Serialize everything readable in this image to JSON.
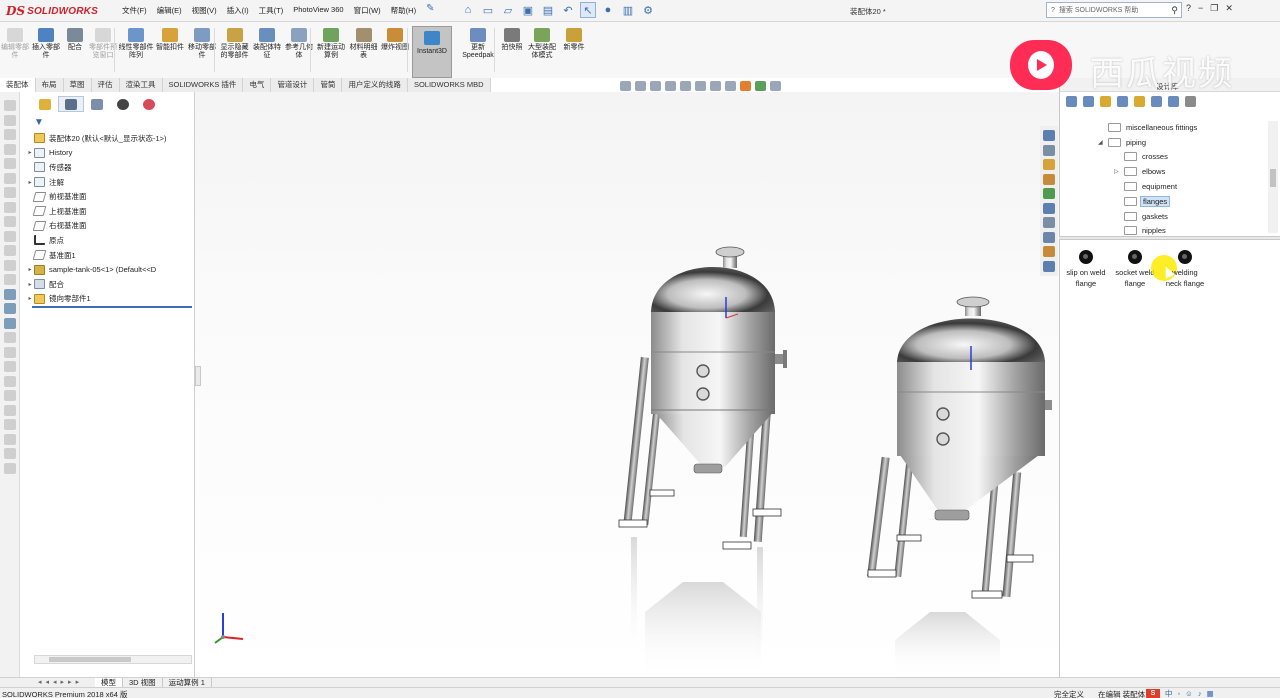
{
  "app": {
    "logo_ds": "DS",
    "logo_text": "SOLIDWORKS",
    "doc_title": "装配体20 *",
    "help_search_placeholder": "搜索 SOLIDWORKS 帮助"
  },
  "menu": [
    "文件(F)",
    "编辑(E)",
    "视图(V)",
    "插入(I)",
    "工具(T)",
    "PhotoView 360",
    "窗口(W)",
    "帮助(H)"
  ],
  "window_controls": [
    "?",
    "−",
    "❐",
    "✕"
  ],
  "ribbon": {
    "buttons": [
      {
        "label": "编辑零部件",
        "disabled": true,
        "color": "#c9c9c9"
      },
      {
        "label": "插入零部件",
        "disabled": false,
        "color": "#4f82c0"
      },
      {
        "label": "配合",
        "disabled": false,
        "color": "#7a8a99"
      },
      {
        "label": "零部件预览窗口",
        "disabled": true,
        "color": "#c9c9c9"
      },
      {
        "label": "线性零部件阵列",
        "disabled": false,
        "color": "#6c95c9"
      },
      {
        "label": "智能扣件",
        "disabled": false,
        "color": "#d8a23a"
      },
      {
        "label": "移动零部件",
        "disabled": false,
        "color": "#7e9cc2"
      },
      {
        "label": "显示隐藏的零部件",
        "disabled": false,
        "color": "#c9a245"
      },
      {
        "label": "装配体特征",
        "disabled": false,
        "color": "#6b8fbd"
      },
      {
        "label": "参考几何体",
        "disabled": false,
        "color": "#8aa1c0"
      },
      {
        "label": "新建运动算例",
        "disabled": false,
        "color": "#6fa35e"
      },
      {
        "label": "材料明细表",
        "disabled": false,
        "color": "#a18f6e"
      },
      {
        "label": "爆炸视图",
        "disabled": false,
        "color": "#c98d3a"
      },
      {
        "label": "更新 Speedpak",
        "disabled": false,
        "color": "#6d8cc0"
      },
      {
        "label": "拍快照",
        "disabled": false,
        "color": "#7a7a7a"
      },
      {
        "label": "大型装配体模式",
        "disabled": false,
        "color": "#7aa45a"
      },
      {
        "label": "新零件",
        "disabled": false,
        "color": "#c9a13a"
      }
    ],
    "instant3d_label": "Instant3D"
  },
  "command_tabs": [
    "装配体",
    "布局",
    "草图",
    "评估",
    "渲染工具",
    "SOLIDWORKS 插件",
    "电气",
    "管道设计",
    "管筒",
    "用户定义的线路",
    "SOLIDWORKS MBD"
  ],
  "feature_tree": {
    "root": "装配体20 (默认<默认_显示状态-1>)",
    "items": [
      {
        "label": "History",
        "icon": "history-icon",
        "expandable": true
      },
      {
        "label": "传感器",
        "icon": "sensor-icon",
        "expandable": false
      },
      {
        "label": "注解",
        "icon": "annotation-icon",
        "expandable": true
      },
      {
        "label": "前视基准面",
        "icon": "plane-icon",
        "expandable": false
      },
      {
        "label": "上视基准面",
        "icon": "plane-icon",
        "expandable": false
      },
      {
        "label": "右视基准面",
        "icon": "plane-icon",
        "expandable": false
      },
      {
        "label": "原点",
        "icon": "origin-icon",
        "expandable": false
      },
      {
        "label": "基准面1",
        "icon": "plane-icon",
        "expandable": false
      },
      {
        "label": "sample-tank-05<1> (Default<<D",
        "icon": "part-icon",
        "expandable": true
      },
      {
        "label": "配合",
        "icon": "mate-icon",
        "expandable": true
      },
      {
        "label": "镜向零部件1",
        "icon": "mirror-icon",
        "expandable": true
      }
    ]
  },
  "task_pane": {
    "header": "设计库",
    "folders": [
      {
        "label": "miscellaneous fittings",
        "level": 1,
        "expander": "",
        "selected": false
      },
      {
        "label": "piping",
        "level": 1,
        "expander": "◢",
        "selected": false
      },
      {
        "label": "crosses",
        "level": 2,
        "expander": "",
        "selected": false
      },
      {
        "label": "elbows",
        "level": 2,
        "expander": "▷",
        "selected": false
      },
      {
        "label": "equipment",
        "level": 2,
        "expander": "",
        "selected": false
      },
      {
        "label": "flanges",
        "level": 2,
        "expander": "",
        "selected": true
      },
      {
        "label": "gaskets",
        "level": 2,
        "expander": "",
        "selected": false
      },
      {
        "label": "nipples",
        "level": 2,
        "expander": "",
        "selected": false
      }
    ],
    "flanges": [
      {
        "line1": "slip on weld",
        "line2": "flange"
      },
      {
        "line1": "socket weld",
        "line2": "flange"
      },
      {
        "line1": "welding",
        "line2": "neck flange"
      }
    ]
  },
  "watermark": {
    "text": "西瓜视频"
  },
  "bottom_tabs": [
    "模型",
    "3D 视图",
    "运动算例 1"
  ],
  "status": {
    "product": "SOLIDWORKS Premium 2018 x64 版",
    "right": [
      "完全定义",
      "在编辑 装配体"
    ],
    "ime_badge": "S",
    "ime_label": "中"
  },
  "colors": {
    "accent": "#3f6cb4",
    "brand_red": "#d0202a",
    "selection": "#cfe2f6",
    "watermark_logo": "#ff2d55"
  }
}
